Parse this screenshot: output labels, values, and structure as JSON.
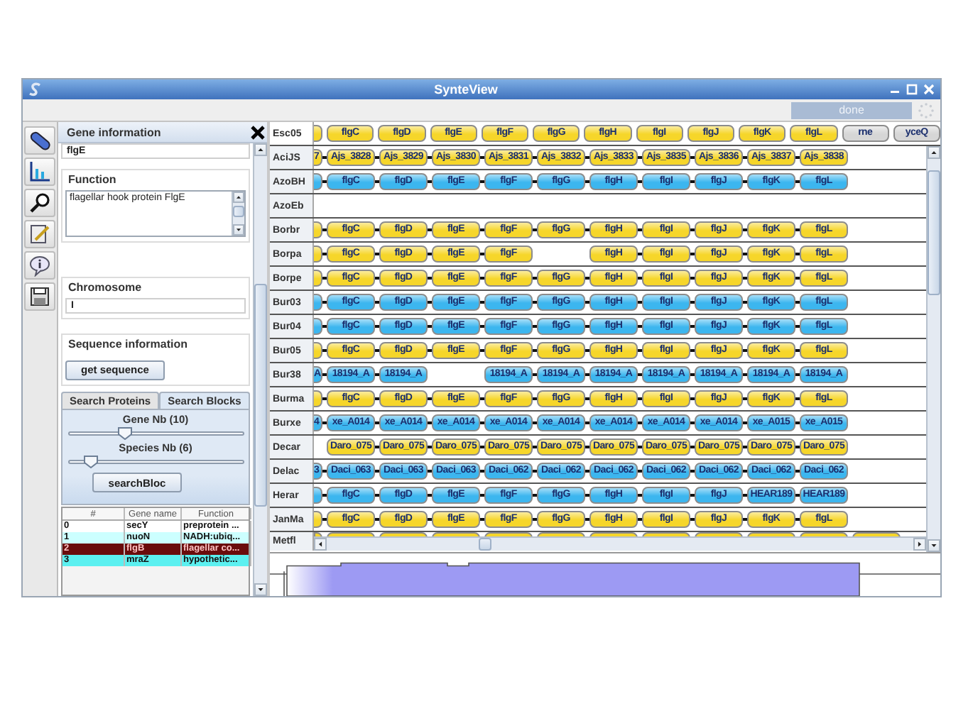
{
  "window": {
    "title": "SynteView"
  },
  "status": {
    "text": "done"
  },
  "gene_panel": {
    "title": "Gene information",
    "name": "flgE",
    "function_label": "Function",
    "function": "flagellar hook protein FlgE",
    "chromosome_label": "Chromosome",
    "chromosome": "I",
    "sequence_label": "Sequence information",
    "sequence_button": "get sequence",
    "tabs": [
      {
        "label": "Search Proteins",
        "selected": false
      },
      {
        "label": "Search Blocks",
        "selected": true
      }
    ],
    "sliders": [
      {
        "label": "Gene Nb (10)",
        "level": 0.33
      },
      {
        "label": "Species Nb (6)",
        "level": 0.13
      }
    ],
    "search_button": "searchBloc",
    "table": {
      "columns": [
        "#",
        "Gene name",
        "Function"
      ],
      "rows": [
        {
          "cells": [
            "0",
            "secY",
            "preprotein ..."
          ],
          "color": "#ffffff",
          "selected": false
        },
        {
          "cells": [
            "1",
            "nuoN",
            "NADH:ubiq..."
          ],
          "color": "#ccffff",
          "selected": false
        },
        {
          "cells": [
            "2",
            "flgB",
            "flagellar co..."
          ],
          "color": "#6a0c0c",
          "selected": true
        },
        {
          "cells": [
            "3",
            "mraZ",
            "hypothetic..."
          ],
          "color": "#5cf0f0",
          "selected": false
        }
      ]
    }
  },
  "synteny": {
    "rows": [
      {
        "name": "Esc05",
        "color": "#f6d62a",
        "reference": true,
        "genes": [
          {
            "kind": "stub"
          },
          {
            "kind": "gene",
            "label": "flgC"
          },
          {
            "kind": "gene",
            "label": "flgD"
          },
          {
            "kind": "gene",
            "label": "flgE"
          },
          {
            "kind": "gene",
            "label": "flgF"
          },
          {
            "kind": "gene",
            "label": "flgG"
          },
          {
            "kind": "gene",
            "label": "flgH"
          },
          {
            "kind": "gene",
            "label": "flgI"
          },
          {
            "kind": "gene",
            "label": "flgJ"
          },
          {
            "kind": "gene",
            "label": "flgK"
          },
          {
            "kind": "gene",
            "label": "flgL"
          },
          {
            "kind": "gene",
            "label": "rne",
            "color": "#d6d6d6"
          },
          {
            "kind": "gene",
            "label": "yceQ",
            "color": "#d6d6d6"
          }
        ]
      },
      {
        "name": "AciJS",
        "color": "#f6d62a",
        "reference": false,
        "genes": [
          {
            "kind": "stub",
            "label": "7"
          },
          {
            "kind": "gene",
            "label": "Ajs_3828"
          },
          {
            "kind": "gene",
            "label": "Ajs_3829"
          },
          {
            "kind": "gene",
            "label": "Ajs_3830"
          },
          {
            "kind": "gene",
            "label": "Ajs_3831"
          },
          {
            "kind": "gene",
            "label": "Ajs_3832"
          },
          {
            "kind": "gene",
            "label": "Ajs_3833"
          },
          {
            "kind": "gene",
            "label": "Ajs_3835"
          },
          {
            "kind": "gene",
            "label": "Ajs_3836"
          },
          {
            "kind": "gene",
            "label": "Ajs_3837"
          },
          {
            "kind": "gene",
            "label": "Ajs_3838"
          }
        ]
      },
      {
        "name": "AzoBH",
        "color": "#3cb6ef",
        "reference": false,
        "genes": [
          {
            "kind": "stub"
          },
          {
            "kind": "gene",
            "label": "flgC"
          },
          {
            "kind": "gene",
            "label": "flgD"
          },
          {
            "kind": "gene",
            "label": "flgE"
          },
          {
            "kind": "gene",
            "label": "flgF"
          },
          {
            "kind": "gene",
            "label": "flgG"
          },
          {
            "kind": "gene",
            "label": "flgH"
          },
          {
            "kind": "gene",
            "label": "flgI"
          },
          {
            "kind": "gene",
            "label": "flgJ"
          },
          {
            "kind": "gene",
            "label": "flgK"
          },
          {
            "kind": "gene",
            "label": "flgL"
          }
        ]
      },
      {
        "name": "AzoEb",
        "reference": false,
        "genes": []
      },
      {
        "name": "Borbr",
        "color": "#f6d62a",
        "reference": false,
        "genes": [
          {
            "kind": "stub"
          },
          {
            "kind": "gene",
            "label": "flgC"
          },
          {
            "kind": "gene",
            "label": "flgD"
          },
          {
            "kind": "gene",
            "label": "flgE"
          },
          {
            "kind": "gene",
            "label": "flgF"
          },
          {
            "kind": "gene",
            "label": "flgG"
          },
          {
            "kind": "gene",
            "label": "flgH"
          },
          {
            "kind": "gene",
            "label": "flgI"
          },
          {
            "kind": "gene",
            "label": "flgJ"
          },
          {
            "kind": "gene",
            "label": "flgK"
          },
          {
            "kind": "gene",
            "label": "flgL"
          }
        ]
      },
      {
        "name": "Borpa",
        "color": "#f6d62a",
        "reference": false,
        "genes": [
          {
            "kind": "stub"
          },
          {
            "kind": "gene",
            "label": "flgC"
          },
          {
            "kind": "gene",
            "label": "flgD"
          },
          {
            "kind": "gene",
            "label": "flgE"
          },
          {
            "kind": "gene",
            "label": "flgF"
          },
          {
            "kind": "gap"
          },
          {
            "kind": "gene",
            "label": "flgH"
          },
          {
            "kind": "gene",
            "label": "flgI"
          },
          {
            "kind": "gene",
            "label": "flgJ"
          },
          {
            "kind": "gene",
            "label": "flgK"
          },
          {
            "kind": "gene",
            "label": "flgL"
          }
        ]
      },
      {
        "name": "Borpe",
        "color": "#f6d62a",
        "reference": false,
        "genes": [
          {
            "kind": "stub"
          },
          {
            "kind": "gene",
            "label": "flgC"
          },
          {
            "kind": "gene",
            "label": "flgD"
          },
          {
            "kind": "gene",
            "label": "flgE"
          },
          {
            "kind": "gene",
            "label": "flgF"
          },
          {
            "kind": "gene",
            "label": "flgG"
          },
          {
            "kind": "gene",
            "label": "flgH"
          },
          {
            "kind": "gene",
            "label": "flgI"
          },
          {
            "kind": "gene",
            "label": "flgJ"
          },
          {
            "kind": "gene",
            "label": "flgK"
          },
          {
            "kind": "gene",
            "label": "flgL"
          }
        ]
      },
      {
        "name": "Bur03",
        "color": "#3cb6ef",
        "reference": false,
        "genes": [
          {
            "kind": "stub"
          },
          {
            "kind": "gene",
            "label": "flgC"
          },
          {
            "kind": "gene",
            "label": "flgD"
          },
          {
            "kind": "gene",
            "label": "flgE"
          },
          {
            "kind": "gene",
            "label": "flgF"
          },
          {
            "kind": "gene",
            "label": "flgG"
          },
          {
            "kind": "gene",
            "label": "flgH"
          },
          {
            "kind": "gene",
            "label": "flgI"
          },
          {
            "kind": "gene",
            "label": "flgJ"
          },
          {
            "kind": "gene",
            "label": "flgK"
          },
          {
            "kind": "gene",
            "label": "flgL"
          }
        ]
      },
      {
        "name": "Bur04",
        "color": "#3cb6ef",
        "reference": false,
        "genes": [
          {
            "kind": "stub"
          },
          {
            "kind": "gene",
            "label": "flgC"
          },
          {
            "kind": "gene",
            "label": "flgD"
          },
          {
            "kind": "gene",
            "label": "flgE"
          },
          {
            "kind": "gene",
            "label": "flgF"
          },
          {
            "kind": "gene",
            "label": "flgG"
          },
          {
            "kind": "gene",
            "label": "flgH"
          },
          {
            "kind": "gene",
            "label": "flgI"
          },
          {
            "kind": "gene",
            "label": "flgJ"
          },
          {
            "kind": "gene",
            "label": "flgK"
          },
          {
            "kind": "gene",
            "label": "flgL"
          }
        ]
      },
      {
        "name": "Bur05",
        "color": "#f6d62a",
        "reference": false,
        "genes": [
          {
            "kind": "stub"
          },
          {
            "kind": "gene",
            "label": "flgC"
          },
          {
            "kind": "gene",
            "label": "flgD"
          },
          {
            "kind": "gene",
            "label": "flgE"
          },
          {
            "kind": "gene",
            "label": "flgF"
          },
          {
            "kind": "gene",
            "label": "flgG"
          },
          {
            "kind": "gene",
            "label": "flgH"
          },
          {
            "kind": "gene",
            "label": "flgI"
          },
          {
            "kind": "gene",
            "label": "flgJ"
          },
          {
            "kind": "gene",
            "label": "flgK"
          },
          {
            "kind": "gene",
            "label": "flgL"
          }
        ]
      },
      {
        "name": "Bur38",
        "color": "#3cb6ef",
        "reference": false,
        "genes": [
          {
            "kind": "stub",
            "label": "A"
          },
          {
            "kind": "gene",
            "label": "18194_A"
          },
          {
            "kind": "gene",
            "label": "18194_A"
          },
          {
            "kind": "gap"
          },
          {
            "kind": "gene",
            "label": "18194_A"
          },
          {
            "kind": "gene",
            "label": "18194_A"
          },
          {
            "kind": "gene",
            "label": "18194_A"
          },
          {
            "kind": "gene",
            "label": "18194_A"
          },
          {
            "kind": "gene",
            "label": "18194_A"
          },
          {
            "kind": "gene",
            "label": "18194_A"
          },
          {
            "kind": "gene",
            "label": "18194_A"
          }
        ]
      },
      {
        "name": "Burma",
        "color": "#f6d62a",
        "reference": false,
        "genes": [
          {
            "kind": "stub"
          },
          {
            "kind": "gene",
            "label": "flgC"
          },
          {
            "kind": "gene",
            "label": "flgD"
          },
          {
            "kind": "gene",
            "label": "flgE"
          },
          {
            "kind": "gene",
            "label": "flgF"
          },
          {
            "kind": "gene",
            "label": "flgG"
          },
          {
            "kind": "gene",
            "label": "flgH"
          },
          {
            "kind": "gene",
            "label": "flgI"
          },
          {
            "kind": "gene",
            "label": "flgJ"
          },
          {
            "kind": "gene",
            "label": "flgK"
          },
          {
            "kind": "gene",
            "label": "flgL"
          }
        ]
      },
      {
        "name": "Burxe",
        "color": "#3cb6ef",
        "reference": false,
        "genes": [
          {
            "kind": "stub",
            "label": "4"
          },
          {
            "kind": "gene",
            "label": "xe_A014"
          },
          {
            "kind": "gene",
            "label": "xe_A014"
          },
          {
            "kind": "gene",
            "label": "xe_A014"
          },
          {
            "kind": "gene",
            "label": "xe_A014"
          },
          {
            "kind": "gene",
            "label": "xe_A014"
          },
          {
            "kind": "gene",
            "label": "xe_A014"
          },
          {
            "kind": "gene",
            "label": "xe_A014"
          },
          {
            "kind": "gene",
            "label": "xe_A014"
          },
          {
            "kind": "gene",
            "label": "xe_A015"
          },
          {
            "kind": "gene",
            "label": "xe_A015"
          }
        ]
      },
      {
        "name": "Decar",
        "color": "#f6d62a",
        "reference": false,
        "genes": [
          {
            "kind": "pad"
          },
          {
            "kind": "gene",
            "label": "Daro_075"
          },
          {
            "kind": "gene",
            "label": "Daro_075"
          },
          {
            "kind": "gene",
            "label": "Daro_075"
          },
          {
            "kind": "gene",
            "label": "Daro_075"
          },
          {
            "kind": "gene",
            "label": "Daro_075"
          },
          {
            "kind": "gene",
            "label": "Daro_075"
          },
          {
            "kind": "gene",
            "label": "Daro_075"
          },
          {
            "kind": "gene",
            "label": "Daro_075"
          },
          {
            "kind": "gene",
            "label": "Daro_075"
          },
          {
            "kind": "gene",
            "label": "Daro_075"
          }
        ]
      },
      {
        "name": "Delac",
        "color": "#3cb6ef",
        "reference": false,
        "genes": [
          {
            "kind": "stub",
            "label": "3"
          },
          {
            "kind": "gene",
            "label": "Daci_063"
          },
          {
            "kind": "gene",
            "label": "Daci_063"
          },
          {
            "kind": "gene",
            "label": "Daci_063"
          },
          {
            "kind": "gene",
            "label": "Daci_062"
          },
          {
            "kind": "gene",
            "label": "Daci_062"
          },
          {
            "kind": "gene",
            "label": "Daci_062"
          },
          {
            "kind": "gene",
            "label": "Daci_062"
          },
          {
            "kind": "gene",
            "label": "Daci_062"
          },
          {
            "kind": "gene",
            "label": "Daci_062"
          },
          {
            "kind": "gene",
            "label": "Daci_062"
          }
        ]
      },
      {
        "name": "Herar",
        "color": "#3cb6ef",
        "reference": false,
        "genes": [
          {
            "kind": "stub"
          },
          {
            "kind": "gene",
            "label": "flgC"
          },
          {
            "kind": "gene",
            "label": "flgD"
          },
          {
            "kind": "gene",
            "label": "flgE"
          },
          {
            "kind": "gene",
            "label": "flgF"
          },
          {
            "kind": "gene",
            "label": "flgG"
          },
          {
            "kind": "gene",
            "label": "flgH"
          },
          {
            "kind": "gene",
            "label": "flgI"
          },
          {
            "kind": "gene",
            "label": "flgJ"
          },
          {
            "kind": "gene",
            "label": "HEAR189"
          },
          {
            "kind": "gene",
            "label": "HEAR189"
          }
        ]
      },
      {
        "name": "JanMa",
        "color": "#f6d62a",
        "reference": false,
        "genes": [
          {
            "kind": "stub"
          },
          {
            "kind": "gene",
            "label": "flgC"
          },
          {
            "kind": "gene",
            "label": "flgD"
          },
          {
            "kind": "gene",
            "label": "flgE"
          },
          {
            "kind": "gene",
            "label": "flgF"
          },
          {
            "kind": "gene",
            "label": "flgG"
          },
          {
            "kind": "gene",
            "label": "flgH"
          },
          {
            "kind": "gene",
            "label": "flgI"
          },
          {
            "kind": "gene",
            "label": "flgJ"
          },
          {
            "kind": "gene",
            "label": "flgK"
          },
          {
            "kind": "gene",
            "label": "flgL"
          }
        ]
      },
      {
        "name": "Metfl",
        "color": "#f6d62a",
        "reference": false,
        "partial": true
      }
    ]
  }
}
